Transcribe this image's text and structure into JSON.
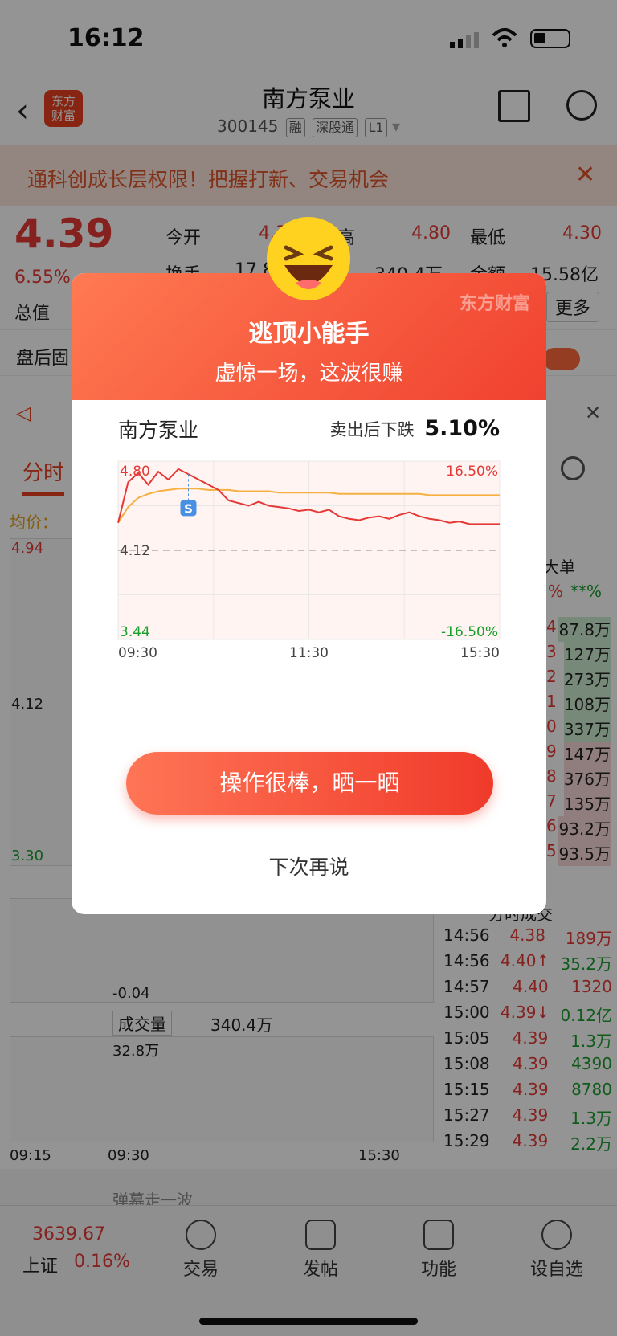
{
  "status": {
    "time": "16:12"
  },
  "nav": {
    "title": "南方泵业",
    "code": "300145",
    "tags": [
      "融",
      "深股通",
      "L1"
    ],
    "logo": "东方\n财富"
  },
  "banner": {
    "text": "通科创成长层权限！把握打新、交易机会"
  },
  "quote": {
    "price": "4.39",
    "change_pct": "6.55%",
    "open_label": "今开",
    "open": "4.39",
    "high_label": "最高",
    "high": "4.80",
    "low_label": "最低",
    "low": "4.30",
    "turnover_label": "换手",
    "turnover": "17.8",
    "vol": "340.4万",
    "amount_label": "金额",
    "amount": "15.58亿",
    "mcap_label": "总值",
    "more": "更多"
  },
  "after_hours": {
    "label": "盘后固"
  },
  "tabs": {
    "active": "分时"
  },
  "chart_bg": {
    "avg_label": "均价：",
    "top": "4.94",
    "mid": "4.12",
    "bottom": "3.30",
    "macd_val": "-0.04",
    "vol_label": "成交量",
    "vol_value": "340.4万",
    "vol_max": "32.8万",
    "x_start": "09:15",
    "x_mid": "09:30",
    "x_end": "15:30"
  },
  "side": {
    "big_order": "大单",
    "pct_label1": "%",
    "pct_label2": "**%",
    "orders": [
      [
        "4",
        "87.8万"
      ],
      [
        "3",
        "127万"
      ],
      [
        "2",
        "273万"
      ],
      [
        "1",
        "108万"
      ],
      [
        "0",
        "337万"
      ],
      [
        "9",
        "147万"
      ],
      [
        "8",
        "376万"
      ],
      [
        "7",
        "135万"
      ],
      [
        "6",
        "93.2万"
      ],
      [
        "5",
        "93.5万"
      ]
    ],
    "trades_label": "分时成交",
    "trades": [
      [
        "14:56",
        "4.38",
        "189万"
      ],
      [
        "14:56",
        "4.40↑",
        "35.2万"
      ],
      [
        "14:57",
        "4.40",
        "1320"
      ],
      [
        "15:00",
        "4.39↓",
        "0.12亿"
      ],
      [
        "15:05",
        "4.39",
        "1.3万"
      ],
      [
        "15:08",
        "4.39",
        "4390"
      ],
      [
        "15:15",
        "4.39",
        "8780"
      ],
      [
        "15:27",
        "4.39",
        "1.3万"
      ],
      [
        "15:29",
        "4.39",
        "2.2万"
      ]
    ]
  },
  "bottom": {
    "index_value": "3639.67",
    "index_name": "上证",
    "index_pct": "0.16%",
    "trade": "交易",
    "post": "发帖",
    "func": "功能",
    "watch": "设自选",
    "comment_placeholder": "弹幕走一波"
  },
  "modal": {
    "title": "逃顶小能手",
    "subtitle": "虚惊一场，这波很赚",
    "watermark": "东方财富",
    "stock": "南方泵业",
    "drop_label": "卖出后下跌",
    "drop_value": "5.10%",
    "cta": "操作很棒，晒一晒",
    "later": "下次再说",
    "colors": {
      "accent": "#f0412f",
      "avg": "#f5b041",
      "price": "#e53935"
    }
  },
  "chart_data": {
    "type": "line",
    "x": [
      "09:30",
      "11:30",
      "15:30"
    ],
    "price_top": "4.80",
    "ref": "4.12",
    "low": "3.44",
    "pct_top": "16.50%",
    "pct_low": "-16.50%",
    "ylim": [
      3.44,
      4.8
    ],
    "sell_marker": "S",
    "series": [
      {
        "values": [
          4.33,
          4.64,
          4.71,
          4.62,
          4.72,
          4.66,
          4.74,
          4.7,
          4.66,
          4.62,
          4.58,
          4.5,
          4.48,
          4.46,
          4.49,
          4.46,
          4.45,
          4.44,
          4.42,
          4.43,
          4.41,
          4.43,
          4.38,
          4.36,
          4.35,
          4.37,
          4.38,
          4.36,
          4.39,
          4.41,
          4.38,
          4.36,
          4.35,
          4.33,
          4.34,
          4.32,
          4.32,
          4.32,
          4.32
        ]
      },
      {
        "values": [
          4.33,
          4.45,
          4.52,
          4.55,
          4.57,
          4.58,
          4.59,
          4.59,
          4.59,
          4.58,
          4.58,
          4.58,
          4.57,
          4.57,
          4.57,
          4.57,
          4.56,
          4.56,
          4.56,
          4.56,
          4.56,
          4.56,
          4.55,
          4.55,
          4.55,
          4.55,
          4.55,
          4.55,
          4.55,
          4.55,
          4.55,
          4.54,
          4.54,
          4.54,
          4.54,
          4.54,
          4.54,
          4.54,
          4.54
        ]
      }
    ]
  }
}
